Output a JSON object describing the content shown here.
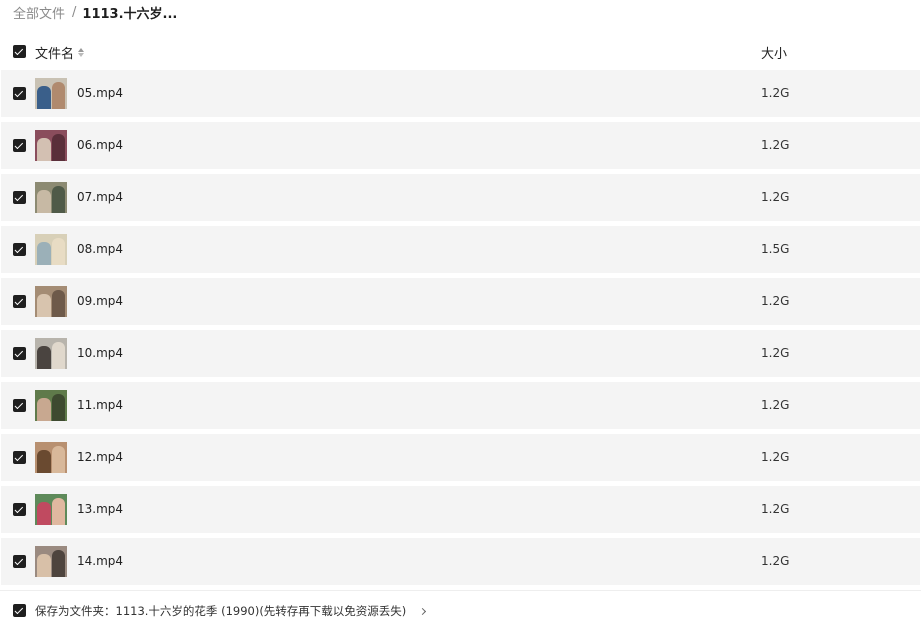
{
  "breadcrumb": {
    "root": "全部文件",
    "separator": "/",
    "current": "1113.十六岁..."
  },
  "header": {
    "name_label": "文件名",
    "size_label": "大小",
    "select_all_checked": true
  },
  "files": [
    {
      "name": "05.mp4",
      "size": "1.2G",
      "checked": true,
      "thumb_colors": [
        "#c9c2b4",
        "#3a5f8a",
        "#b08a6e"
      ]
    },
    {
      "name": "06.mp4",
      "size": "1.2G",
      "checked": true,
      "thumb_colors": [
        "#8a4d5c",
        "#d3c0b2",
        "#5a2f3a"
      ]
    },
    {
      "name": "07.mp4",
      "size": "1.2G",
      "checked": true,
      "thumb_colors": [
        "#8c8a72",
        "#c7b9a4",
        "#4f5a48"
      ]
    },
    {
      "name": "08.mp4",
      "size": "1.5G",
      "checked": true,
      "thumb_colors": [
        "#d8d0b8",
        "#9bb0b8",
        "#e8dcc4"
      ]
    },
    {
      "name": "09.mp4",
      "size": "1.2G",
      "checked": true,
      "thumb_colors": [
        "#a48c74",
        "#d8c4ae",
        "#6e5a4a"
      ]
    },
    {
      "name": "10.mp4",
      "size": "1.2G",
      "checked": true,
      "thumb_colors": [
        "#b8b4ac",
        "#4a4440",
        "#e0d8cc"
      ]
    },
    {
      "name": "11.mp4",
      "size": "1.2G",
      "checked": true,
      "thumb_colors": [
        "#5f7a4a",
        "#c8a890",
        "#3e4a30"
      ]
    },
    {
      "name": "12.mp4",
      "size": "1.2G",
      "checked": true,
      "thumb_colors": [
        "#b89070",
        "#6a4a30",
        "#d8b89a"
      ]
    },
    {
      "name": "13.mp4",
      "size": "1.2G",
      "checked": true,
      "thumb_colors": [
        "#5e8a5a",
        "#c04a60",
        "#e0b8a0"
      ]
    },
    {
      "name": "14.mp4",
      "size": "1.2G",
      "checked": true,
      "thumb_colors": [
        "#9a8a80",
        "#d8c0a8",
        "#4e443e"
      ]
    }
  ],
  "footer": {
    "save_as_text": "保存为文件夹：1113.十六岁的花季 (1990)(先转存再下载以免资源丢失)",
    "checked": true
  }
}
